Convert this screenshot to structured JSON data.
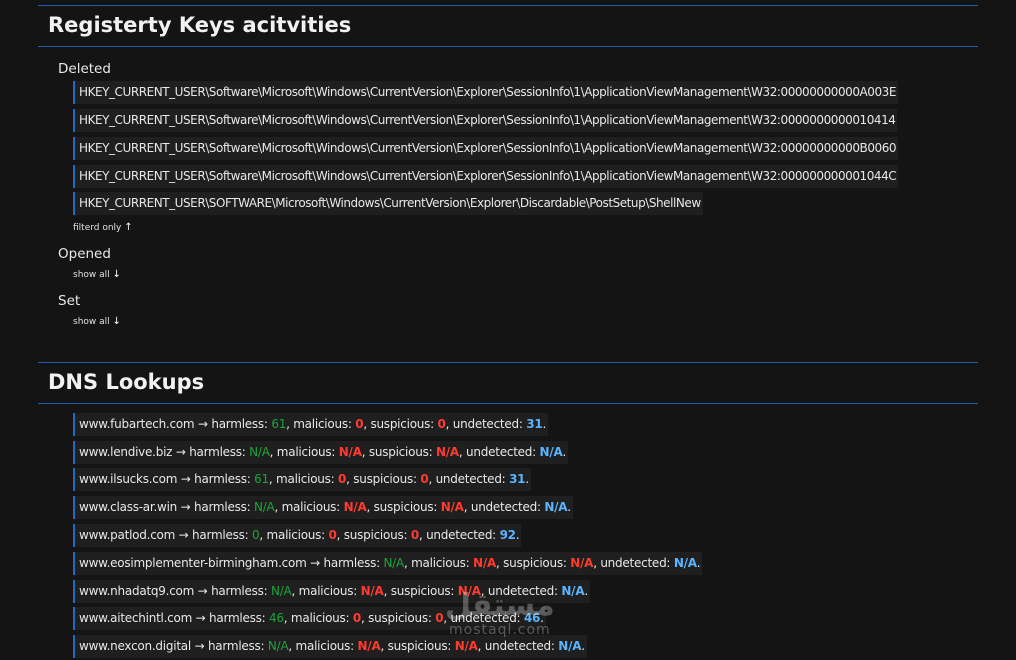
{
  "registry": {
    "title": "Registerty Keys acitvities",
    "deleted": {
      "label": "Deleted",
      "items": [
        "HKEY_CURRENT_USER\\Software\\Microsoft\\Windows\\CurrentVersion\\Explorer\\SessionInfo\\1\\ApplicationViewManagement\\W32:00000000000A003E",
        "HKEY_CURRENT_USER\\Software\\Microsoft\\Windows\\CurrentVersion\\Explorer\\SessionInfo\\1\\ApplicationViewManagement\\W32:0000000000010414",
        "HKEY_CURRENT_USER\\Software\\Microsoft\\Windows\\CurrentVersion\\Explorer\\SessionInfo\\1\\ApplicationViewManagement\\W32:00000000000B0060",
        "HKEY_CURRENT_USER\\Software\\Microsoft\\Windows\\CurrentVersion\\Explorer\\SessionInfo\\1\\ApplicationViewManagement\\W32:000000000001044C",
        "HKEY_CURRENT_USER\\SOFTWARE\\Microsoft\\Windows\\CurrentVersion\\Explorer\\Discardable\\PostSetup\\ShellNew"
      ],
      "toggle_label": "filterd only",
      "toggle_arrow": "↑"
    },
    "opened": {
      "label": "Opened",
      "toggle_label": "show all",
      "toggle_arrow": "↓"
    },
    "set": {
      "label": "Set",
      "toggle_label": "show all",
      "toggle_arrow": "↓"
    }
  },
  "dns": {
    "title": "DNS Lookups",
    "labels": {
      "arrow": "→",
      "harmless": "harmless:",
      "malicious": "malicious:",
      "suspicious": "suspicious:",
      "undetected": "undetected:"
    },
    "colors": {
      "harmless": "#1fa33b",
      "malicious": "#ff3b30",
      "suspicious": "#ff3b30",
      "undetected": "#5ab4ff"
    },
    "items": [
      {
        "domain": "www.fubartech.com",
        "harmless": "61",
        "malicious": "0",
        "suspicious": "0",
        "undetected": "31"
      },
      {
        "domain": "www.lendive.biz",
        "harmless": "N/A",
        "malicious": "N/A",
        "suspicious": "N/A",
        "undetected": "N/A"
      },
      {
        "domain": "www.ilsucks.com",
        "harmless": "61",
        "malicious": "0",
        "suspicious": "0",
        "undetected": "31"
      },
      {
        "domain": "www.class-ar.win",
        "harmless": "N/A",
        "malicious": "N/A",
        "suspicious": "N/A",
        "undetected": "N/A"
      },
      {
        "domain": "www.patlod.com",
        "harmless": "0",
        "malicious": "0",
        "suspicious": "0",
        "undetected": "92"
      },
      {
        "domain": "www.eosimplementer-birmingham.com",
        "harmless": "N/A",
        "malicious": "N/A",
        "suspicious": "N/A",
        "undetected": "N/A"
      },
      {
        "domain": "www.nhadatq9.com",
        "harmless": "N/A",
        "malicious": "N/A",
        "suspicious": "N/A",
        "undetected": "N/A"
      },
      {
        "domain": "www.aitechintl.com",
        "harmless": "46",
        "malicious": "0",
        "suspicious": "0",
        "undetected": "46"
      },
      {
        "domain": "www.nexcon.digital",
        "harmless": "N/A",
        "malicious": "N/A",
        "suspicious": "N/A",
        "undetected": "N/A"
      }
    ]
  },
  "watermark": {
    "arabic": "مستقل",
    "latin": "mostaql.com"
  }
}
